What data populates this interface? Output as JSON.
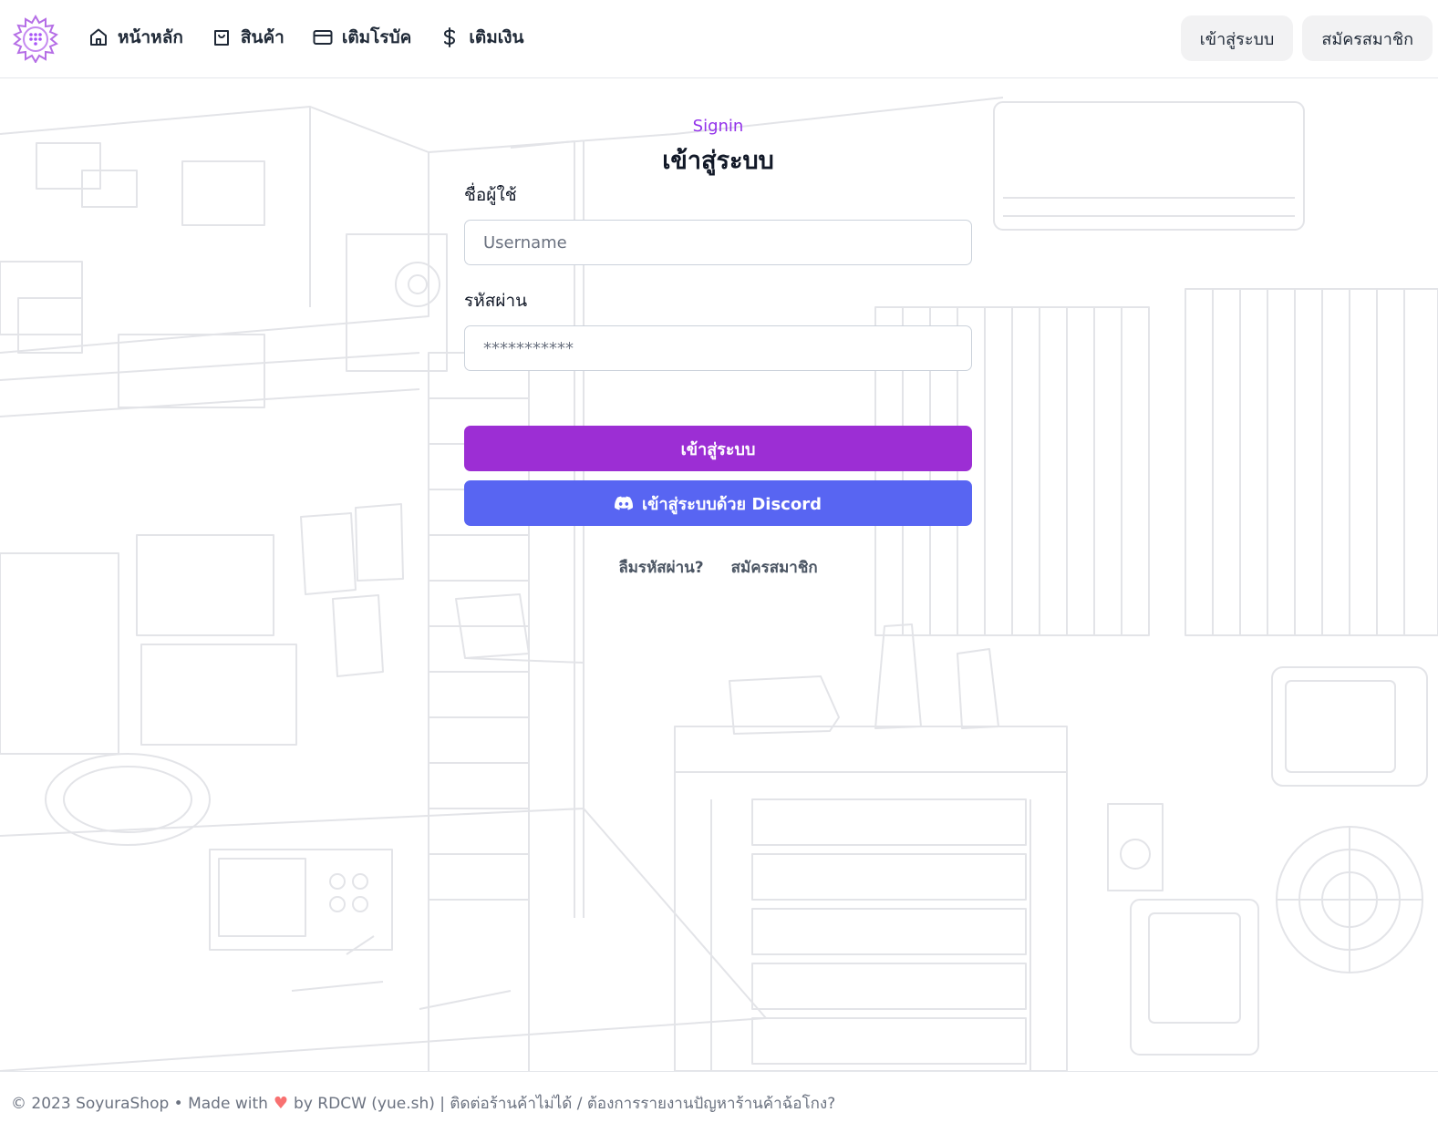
{
  "nav": {
    "items": [
      {
        "label": "หน้าหลัก",
        "icon": "home-icon"
      },
      {
        "label": "สินค้า",
        "icon": "shopping-bag-icon"
      },
      {
        "label": "เติมโรบัค",
        "icon": "credit-card-icon"
      },
      {
        "label": "เติมเงิน",
        "icon": "dollar-icon"
      }
    ],
    "login_label": "เข้าสู่ระบบ",
    "register_label": "สมัครสมาชิก"
  },
  "form": {
    "eyebrow": "Signin",
    "title": "เข้าสู่ระบบ",
    "username_label": "ชื่อผู้ใช้",
    "username_placeholder": "Username",
    "password_label": "รหัสผ่าน",
    "password_placeholder": "***********",
    "submit_label": "เข้าสู่ระบบ",
    "discord_label": "เข้าสู่ระบบด้วย Discord",
    "forgot_label": "ลืมรหัสผ่าน?",
    "register_label": "สมัครสมาชิก"
  },
  "footer": {
    "prefix": "© 2023 SoyuraShop • Made with",
    "heart": "♥",
    "suffix": "by RDCW (yue.sh) | ติดต่อร้านค้าไม่ได้ / ต้องการรายงานปัญหาร้านค้าฉ้อโกง?"
  },
  "colors": {
    "accent": "#9333ea",
    "primary_button": "#9c2ed4",
    "discord": "#5865f2"
  }
}
